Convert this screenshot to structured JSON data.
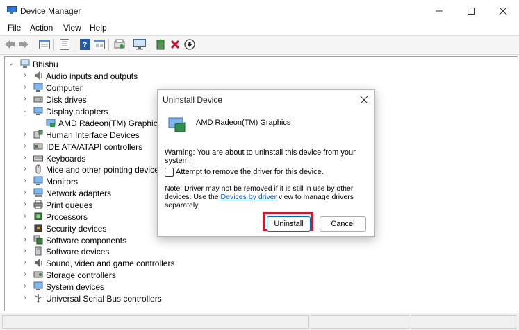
{
  "window": {
    "title": "Device Manager",
    "app_icon": "device-manager-icon"
  },
  "menubar": {
    "items": [
      "File",
      "Action",
      "View",
      "Help"
    ]
  },
  "toolbar": {
    "buttons": [
      "back-arrow-icon",
      "forward-arrow-icon",
      "properties-icon",
      "device-list-icon",
      "help-icon",
      "show-hidden-icon",
      "scan-hardware-icon",
      "monitor-icon",
      "update-driver-icon",
      "uninstall-x-icon",
      "download-icon"
    ],
    "accent_uninstall": "#c8102e"
  },
  "tree": {
    "root": "Bhishu",
    "items": [
      {
        "label": "Audio inputs and outputs",
        "icon": "speaker-icon",
        "expanded": false
      },
      {
        "label": "Computer",
        "icon": "computer-icon",
        "expanded": false
      },
      {
        "label": "Disk drives",
        "icon": "disk-icon",
        "expanded": false
      },
      {
        "label": "Display adapters",
        "icon": "display-adapter-icon",
        "expanded": true
      },
      {
        "label": "AMD Radeon(TM) Graphics",
        "icon": "gpu-icon",
        "child": true
      },
      {
        "label": "Human Interface Devices",
        "icon": "hid-icon",
        "expanded": false
      },
      {
        "label": "IDE ATA/ATAPI controllers",
        "icon": "ide-icon",
        "expanded": false
      },
      {
        "label": "Keyboards",
        "icon": "keyboard-icon",
        "expanded": false
      },
      {
        "label": "Mice and other pointing devices",
        "icon": "mouse-icon",
        "expanded": false
      },
      {
        "label": "Monitors",
        "icon": "monitor-icon",
        "expanded": false
      },
      {
        "label": "Network adapters",
        "icon": "network-icon",
        "expanded": false
      },
      {
        "label": "Print queues",
        "icon": "printer-icon",
        "expanded": false
      },
      {
        "label": "Processors",
        "icon": "processor-icon",
        "expanded": false
      },
      {
        "label": "Security devices",
        "icon": "security-icon",
        "expanded": false
      },
      {
        "label": "Software components",
        "icon": "software-component-icon",
        "expanded": false
      },
      {
        "label": "Software devices",
        "icon": "software-device-icon",
        "expanded": false
      },
      {
        "label": "Sound, video and game controllers",
        "icon": "sound-icon",
        "expanded": false
      },
      {
        "label": "Storage controllers",
        "icon": "storage-icon",
        "expanded": false
      },
      {
        "label": "System devices",
        "icon": "system-icon",
        "expanded": false
      },
      {
        "label": "Universal Serial Bus controllers",
        "icon": "usb-icon",
        "expanded": false
      }
    ]
  },
  "dialog": {
    "title": "Uninstall Device",
    "device_name": "AMD Radeon(TM) Graphics",
    "warning": "Warning: You are about to uninstall this device from your system.",
    "checkbox_label": "Attempt to remove the driver for this device.",
    "checkbox_checked": false,
    "note_before": "Note: Driver may not be removed if it is still in use by other devices. Use the ",
    "note_link": "Devices by driver",
    "note_after": " view to manage drivers separately.",
    "uninstall_label": "Uninstall",
    "cancel_label": "Cancel",
    "highlight_color": "#c31d2e"
  }
}
